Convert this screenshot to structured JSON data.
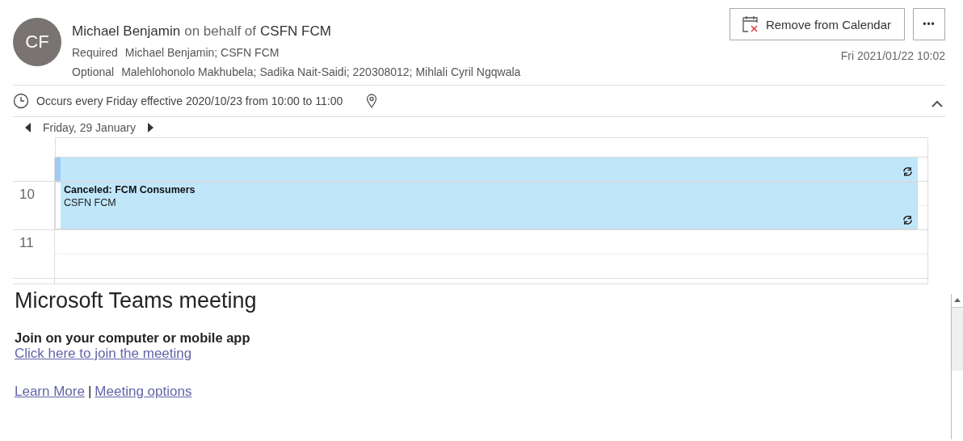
{
  "header": {
    "avatar_initials": "CF",
    "sender": "Michael Benjamin",
    "on_behalf_label": "on behalf of",
    "delegate": "CSFN FCM",
    "required_label": "Required",
    "required": "Michael Benjamin; CSFN FCM",
    "optional_label": "Optional",
    "optional": "Malehlohonolo Makhubela; Sadika Nait-Saidi; 220308012; Mihlali Cyril Ngqwala",
    "remove_button": "Remove from Calendar",
    "more_button": "•••",
    "sent": "Fri 2021/01/22 10:02"
  },
  "recurrence": {
    "text": "Occurs every Friday effective 2020/10/23 from 10:00 to 11:00",
    "expanded": true
  },
  "calendar": {
    "date": "Friday, 29 January",
    "top_event": {
      "recurring": true
    },
    "hours": [
      {
        "label": "10",
        "events": [
          {
            "title": "Canceled: FCM Consumers",
            "organizer": "CSFN FCM",
            "recurring": true
          }
        ]
      },
      {
        "label": "11"
      }
    ]
  },
  "body": {
    "title": "Microsoft Teams meeting",
    "join_heading": "Join on your computer or mobile app",
    "join_link": "Click here to join the meeting",
    "learn_more": "Learn More",
    "separator": "|",
    "options_link": "Meeting options"
  }
}
